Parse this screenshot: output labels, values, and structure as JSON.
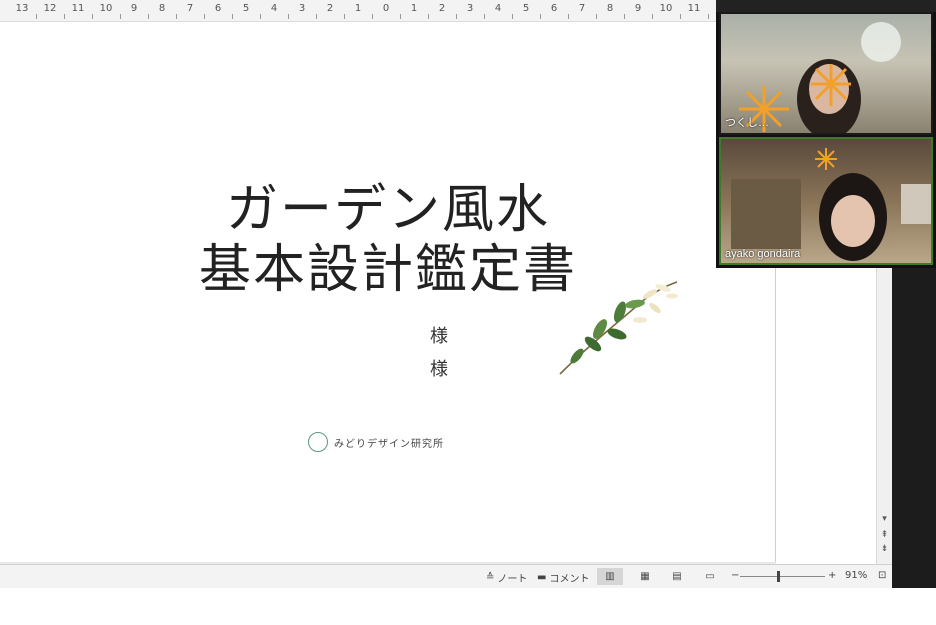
{
  "ruler": {
    "ticks": [
      "13",
      "12",
      "11",
      "10",
      "9",
      "8",
      "7",
      "6",
      "5",
      "4",
      "3",
      "2",
      "1",
      "0",
      "1",
      "2",
      "3",
      "4",
      "5",
      "6",
      "7",
      "8",
      "9",
      "10",
      "11"
    ]
  },
  "slide": {
    "title_line1": "ガーデン風水",
    "title_line2": "基本設計鑑定書",
    "honorific_1": "様",
    "honorific_2": "様",
    "logo_text": "みどりデザイン研究所",
    "logo_mark": "みどり"
  },
  "statusbar": {
    "notes_label": "ノート",
    "comments_label": "コメント",
    "zoom_minus": "−",
    "zoom_plus": "+",
    "zoom_value": "91%",
    "zoom_level": 0.45
  },
  "video": {
    "participant_1_name": "つくし…",
    "participant_2_name": "ayako gondaira"
  },
  "colors": {
    "accent_green": "#5a9a79",
    "speaker_border": "#3f7a2b",
    "sticker_orange": "#f2a02a"
  },
  "icons": [
    "notes-icon",
    "comments-icon",
    "normal-view-icon",
    "slide-sorter-icon",
    "reading-view-icon",
    "slideshow-icon",
    "fit-slide-icon",
    "scroll-up-icon",
    "prev-slide-icon",
    "next-slide-icon"
  ]
}
